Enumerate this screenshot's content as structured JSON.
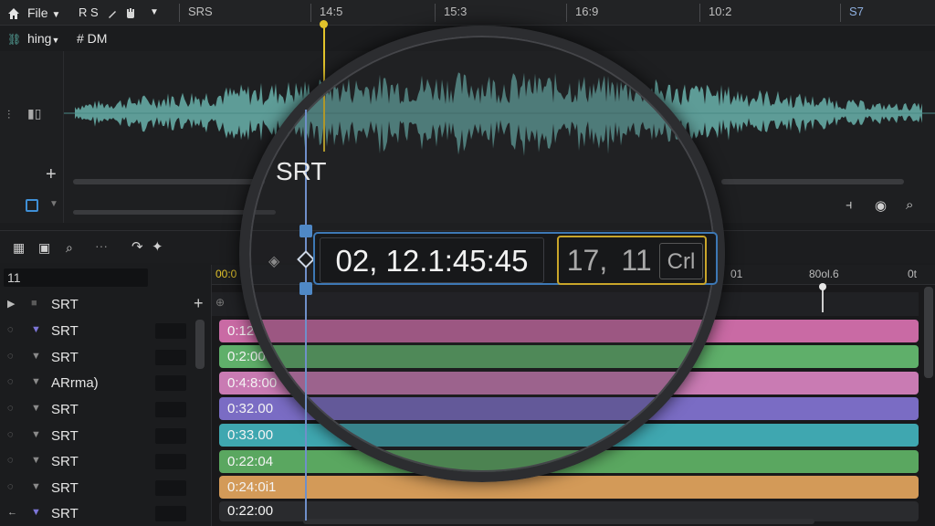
{
  "topbar": {
    "file_menu": "File",
    "home_icon": "home-icon",
    "label_rs": "R S",
    "ruler_labels": [
      "SRS",
      "14:5",
      "15:3",
      "16:9",
      "10:2",
      "S7"
    ]
  },
  "subbar": {
    "workspace": "hing",
    "tag": "# DM"
  },
  "waveform": {
    "overlay_label": "SRT",
    "color": "#5e9c97"
  },
  "timecode": {
    "main": "02, 12.1:45:45",
    "sub_a": "17,",
    "sub_b": "11",
    "sub_c": "Crl"
  },
  "timeline_ruler": {
    "start": "00:0",
    "mid": "01",
    "right": "80ol.6",
    "end": "0t"
  },
  "tracklist": {
    "search_value": "11",
    "tracks": [
      {
        "name": "SRT"
      },
      {
        "name": "SRT"
      },
      {
        "name": "SRT"
      },
      {
        "name": "ARrma)"
      },
      {
        "name": "SRT"
      },
      {
        "name": "SRT"
      },
      {
        "name": "SRT"
      },
      {
        "name": "SRT"
      },
      {
        "name": "SRT"
      }
    ]
  },
  "clips": [
    {
      "time": "0:12",
      "color": "#c96aa4"
    },
    {
      "time": "0:2:00",
      "color": "#5faf6a"
    },
    {
      "time": "0:4:8:00",
      "color": "#c97bb3"
    },
    {
      "time": "0:32.00",
      "color": "#7a6cc4"
    },
    {
      "time": "0:33.00",
      "color": "#3fa7b0"
    },
    {
      "time": "0:22:04",
      "color": "#5aa760"
    },
    {
      "time": "0:24:0i1",
      "color": "#d39a58"
    },
    {
      "time": "0:22:00",
      "color": "#2a2b2e"
    }
  ]
}
